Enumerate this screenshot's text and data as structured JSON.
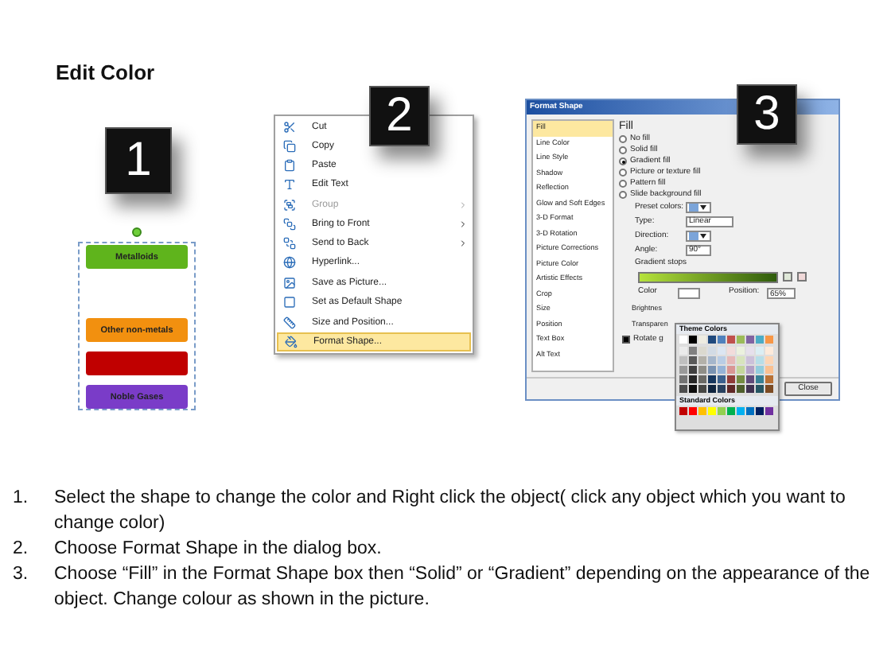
{
  "title": "Edit Color",
  "steps": [
    {
      "number": "1"
    },
    {
      "number": "2"
    },
    {
      "number": "3"
    }
  ],
  "shapes": [
    {
      "label": "Metalloids",
      "color": "#5fb41c"
    },
    {
      "label": "Other non-metals",
      "color": "#f2900f"
    },
    {
      "color": "#c00000"
    },
    {
      "label": "Noble Gases",
      "color": "#7a3cc8"
    }
  ],
  "context_menu": {
    "items": [
      {
        "label": "Cut",
        "disabled": false,
        "submenu": false,
        "selected": false
      },
      {
        "label": "Copy",
        "disabled": false,
        "submenu": false,
        "selected": false
      },
      {
        "label": "Paste",
        "disabled": false,
        "submenu": false,
        "selected": false
      },
      {
        "label": "Edit Text",
        "disabled": false,
        "submenu": false,
        "selected": false
      },
      {
        "label": "Group",
        "disabled": true,
        "submenu": true,
        "selected": false
      },
      {
        "label": "Bring to Front",
        "disabled": false,
        "submenu": true,
        "selected": false
      },
      {
        "label": "Send to Back",
        "disabled": false,
        "submenu": true,
        "selected": false
      },
      {
        "label": "Hyperlink...",
        "disabled": false,
        "submenu": false,
        "selected": false
      },
      {
        "label": "Save as Picture...",
        "disabled": false,
        "submenu": false,
        "selected": false
      },
      {
        "label": "Set as Default Shape",
        "disabled": false,
        "submenu": false,
        "selected": false
      },
      {
        "label": "Size and Position...",
        "disabled": false,
        "submenu": false,
        "selected": false
      },
      {
        "label": "Format Shape...",
        "disabled": false,
        "submenu": false,
        "selected": true
      }
    ]
  },
  "dialog": {
    "title": "Format Shape",
    "categories": [
      {
        "label": "Fill",
        "selected": true
      },
      {
        "label": "Line Color",
        "selected": false
      },
      {
        "label": "Line Style",
        "selected": false
      },
      {
        "label": "Shadow",
        "selected": false
      },
      {
        "label": "Reflection",
        "selected": false
      },
      {
        "label": "Glow and Soft Edges",
        "selected": false
      },
      {
        "label": "3-D Format",
        "selected": false
      },
      {
        "label": "3-D Rotation",
        "selected": false
      },
      {
        "label": "Picture Corrections",
        "selected": false
      },
      {
        "label": "Picture Color",
        "selected": false
      },
      {
        "label": "Artistic Effects",
        "selected": false
      },
      {
        "label": "Crop",
        "selected": false
      },
      {
        "label": "Size",
        "selected": false
      },
      {
        "label": "Position",
        "selected": false
      },
      {
        "label": "Text Box",
        "selected": false
      },
      {
        "label": "Alt Text",
        "selected": false
      }
    ],
    "heading": "Fill",
    "fill_options": [
      {
        "label": "No fill",
        "selected": false
      },
      {
        "label": "Solid fill",
        "selected": false
      },
      {
        "label": "Gradient fill",
        "selected": true
      },
      {
        "label": "Picture or texture fill",
        "selected": false
      },
      {
        "label": "Pattern fill",
        "selected": false
      },
      {
        "label": "Slide background fill",
        "selected": false
      }
    ],
    "fields": [
      {
        "label": "Preset colors:",
        "kind": "picker"
      },
      {
        "label": "Type:",
        "kind": "select",
        "value": "Linear"
      },
      {
        "label": "Direction:",
        "kind": "picker"
      },
      {
        "label": "Angle:",
        "kind": "spin",
        "value": "90°"
      }
    ],
    "stops_label": "Gradient stops",
    "color_label": "Color",
    "position_label": "Position:",
    "position_value": "65%",
    "brightness_label": "Brightnes",
    "transparency_label": "Transparen",
    "rotate": {
      "label": "Rotate g",
      "checked": true
    },
    "close_button": "Close",
    "palette": {
      "theme_label": "Theme Colors",
      "standard_label": "Standard Colors",
      "theme_colors": [
        {
          "color": "#ffffff"
        },
        {
          "color": "#000000"
        },
        {
          "color": "#eeece1"
        },
        {
          "color": "#1f497d"
        },
        {
          "color": "#4f81bd"
        },
        {
          "color": "#c0504d"
        },
        {
          "color": "#9bbb59"
        },
        {
          "color": "#8064a2"
        },
        {
          "color": "#4bacc6"
        },
        {
          "color": "#f79646"
        }
      ],
      "standard_colors": [
        {
          "color": "#c00000"
        },
        {
          "color": "#ff0000"
        },
        {
          "color": "#ffc000"
        },
        {
          "color": "#ffff00"
        },
        {
          "color": "#92d050"
        },
        {
          "color": "#00b050"
        },
        {
          "color": "#00b0f0"
        },
        {
          "color": "#0070c0"
        },
        {
          "color": "#002060"
        },
        {
          "color": "#7030a0"
        }
      ]
    }
  },
  "instructions": [
    {
      "number": "1.",
      "text": "Select the shape to change the color and Right click the object( click any object which you want to change color)"
    },
    {
      "number": "2.",
      "text": "Choose Format Shape in the dialog box."
    },
    {
      "number": "3.",
      "text": "Choose “Fill” in the Format Shape box then “Solid” or “Gradient” depending on the appearance of the object. Change colour as shown in the picture."
    }
  ]
}
